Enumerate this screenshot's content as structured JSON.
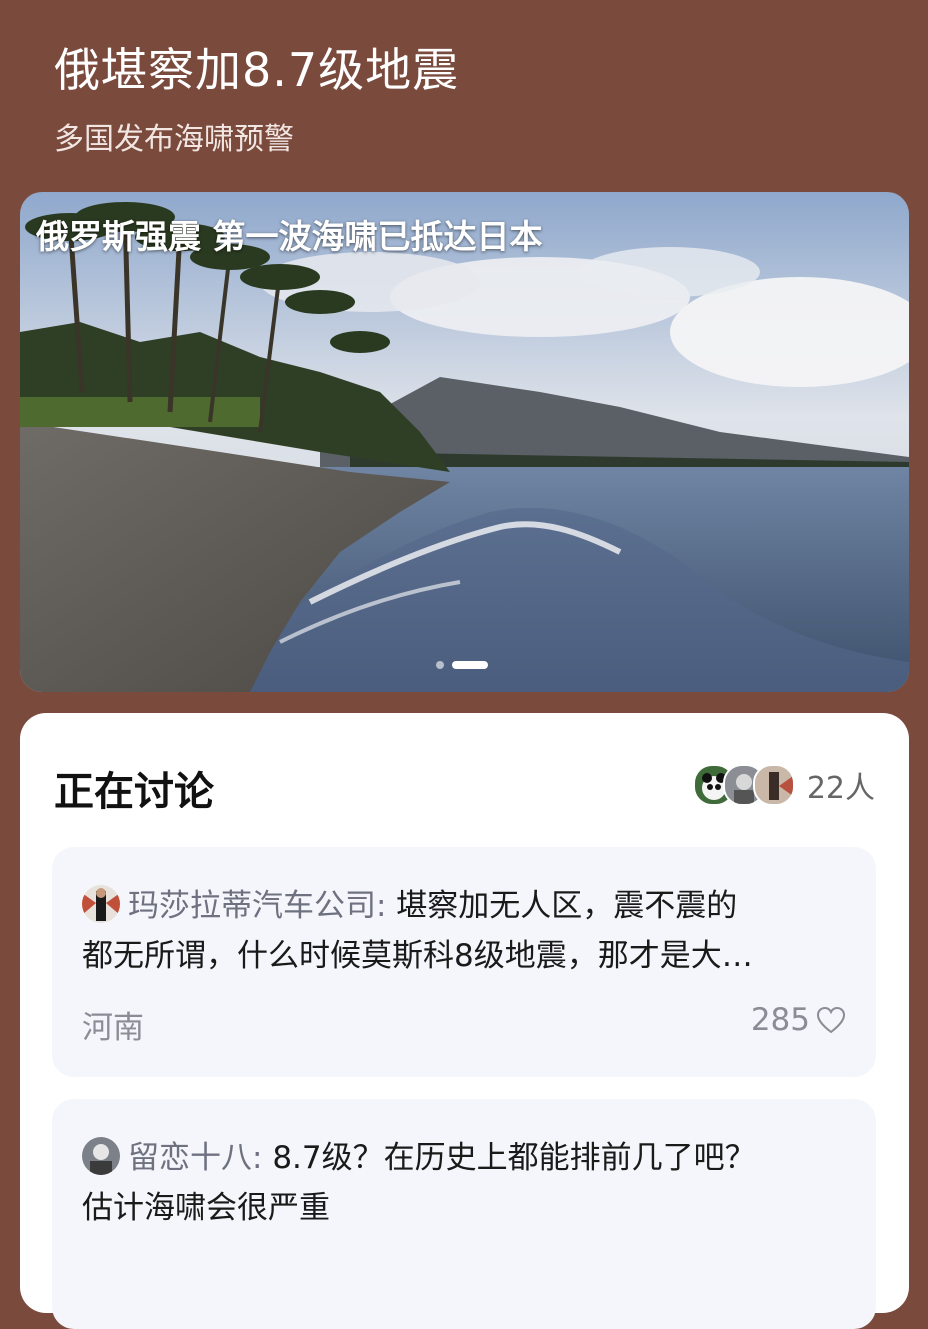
{
  "topic": {
    "title": "俄堪察加8.7级地震",
    "subtitle": "多国发布海啸预警"
  },
  "banner": {
    "caption": "俄罗斯强震 第一波海啸已抵达日本",
    "slides_total": 2,
    "active_slide": 2
  },
  "discussion": {
    "title": "正在讨论",
    "participant_count": "22人",
    "comments": [
      {
        "author": "玛莎拉蒂汽车公司:",
        "text_line1": "堪察加无人区，震不震的",
        "text_line2": "都无所谓，什么时候莫斯科8级地震，那才是大…",
        "location": "河南",
        "likes": "285"
      },
      {
        "author": "留恋十八:",
        "text_line1": "8.7级？在历史上都能排前几了吧？",
        "text_line2": "估计海啸会很严重"
      }
    ]
  },
  "colors": {
    "background": "#7a4a3d",
    "card": "#ffffff",
    "comment_card": "#f5f6fb"
  }
}
